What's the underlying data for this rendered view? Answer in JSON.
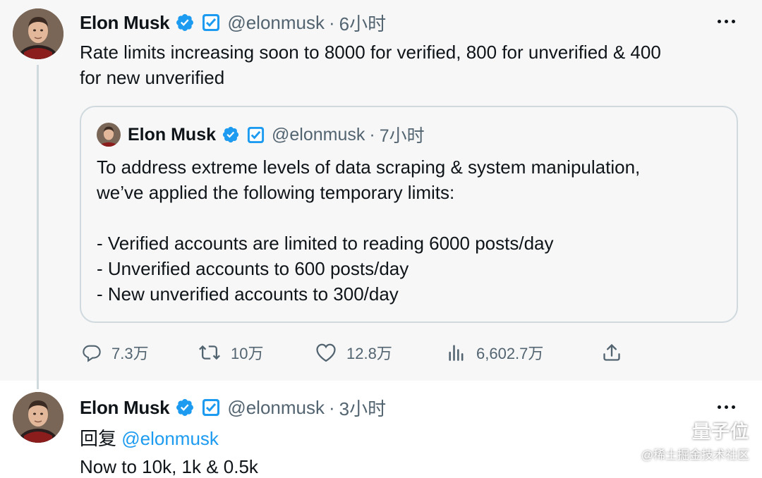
{
  "tweet1": {
    "author": {
      "name": "Elon Musk",
      "handle": "@elonmusk",
      "separator": "·",
      "time": "6小时"
    },
    "text_lines": [
      "Rate limits increasing soon to 8000 for verified, 800 for unverified & 400",
      "for new unverified"
    ],
    "more_icon": "more-horizontal-icon",
    "quote": {
      "author": {
        "name": "Elon Musk",
        "handle": "@elonmusk",
        "separator": "·",
        "time": "7小时"
      },
      "lines": [
        "To address extreme levels of data scraping & system manipulation,",
        "we’ve applied the following temporary limits:",
        "- Verified accounts are limited to reading 6000 posts/day",
        "- Unverified accounts to 600 posts/day",
        "- New unverified accounts to 300/day"
      ]
    },
    "actions": {
      "replies": "7.3万",
      "retweets": "10万",
      "likes": "12.8万",
      "views": "6,602.7万"
    }
  },
  "tweet2": {
    "author": {
      "name": "Elon Musk",
      "handle": "@elonmusk",
      "separator": "·",
      "time": "3小时"
    },
    "reply_prefix": "回复",
    "reply_to": "@elonmusk",
    "text": "Now to 10k, 1k & 0.5k"
  },
  "watermark": {
    "brand": "量子位",
    "sub": "@稀土掘金技术社区"
  },
  "colors": {
    "verified_blue": "#1d9bf0",
    "affiliate_badge": "#1d9bf0",
    "secondary_text": "#536471",
    "border": "#cfd9de",
    "tweet1_bg": "#f7f7f7"
  }
}
